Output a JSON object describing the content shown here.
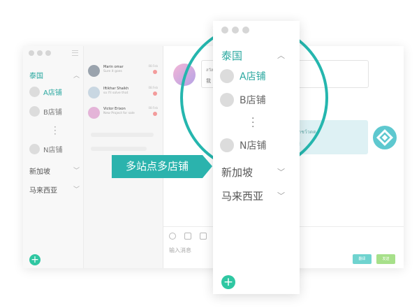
{
  "sidebar": {
    "countries": [
      {
        "label": "泰国",
        "expanded": true
      },
      {
        "label": "新加坡",
        "expanded": false
      },
      {
        "label": "马来西亚",
        "expanded": false
      }
    ],
    "stores": [
      "A店铺",
      "B店铺",
      "N店铺"
    ]
  },
  "conversations": [
    {
      "name": "Marin omar",
      "subtitle": "Sure it goes",
      "time": "08:Feb"
    },
    {
      "name": "Iftikhar Shaikh",
      "subtitle": "so I'll solve that",
      "time": "08:Feb"
    },
    {
      "name": "Victor Erixon",
      "subtitle": "New Project for sale",
      "time": "08:Feb"
    }
  ],
  "chat": {
    "incoming_line1": "สวัสดี",
    "incoming_line2": "我",
    "outgoing_line1": "ไดชว์วดด",
    "outgoing_line2": "换",
    "input_placeholder": "输入消息",
    "btn_left": "翻译",
    "btn_right": "发送"
  },
  "zoom": {
    "country_top": "泰国",
    "stores": [
      "A店铺",
      "B店铺",
      "N店铺"
    ],
    "country_2": "新加坡",
    "country_3": "马来西亚"
  },
  "callout": {
    "label": "多站点多店铺"
  },
  "colors": {
    "accent": "#2bb3ad",
    "green": "#2fc7a2",
    "badge": "#f39b9b",
    "bubble_out": "#def1f4"
  }
}
